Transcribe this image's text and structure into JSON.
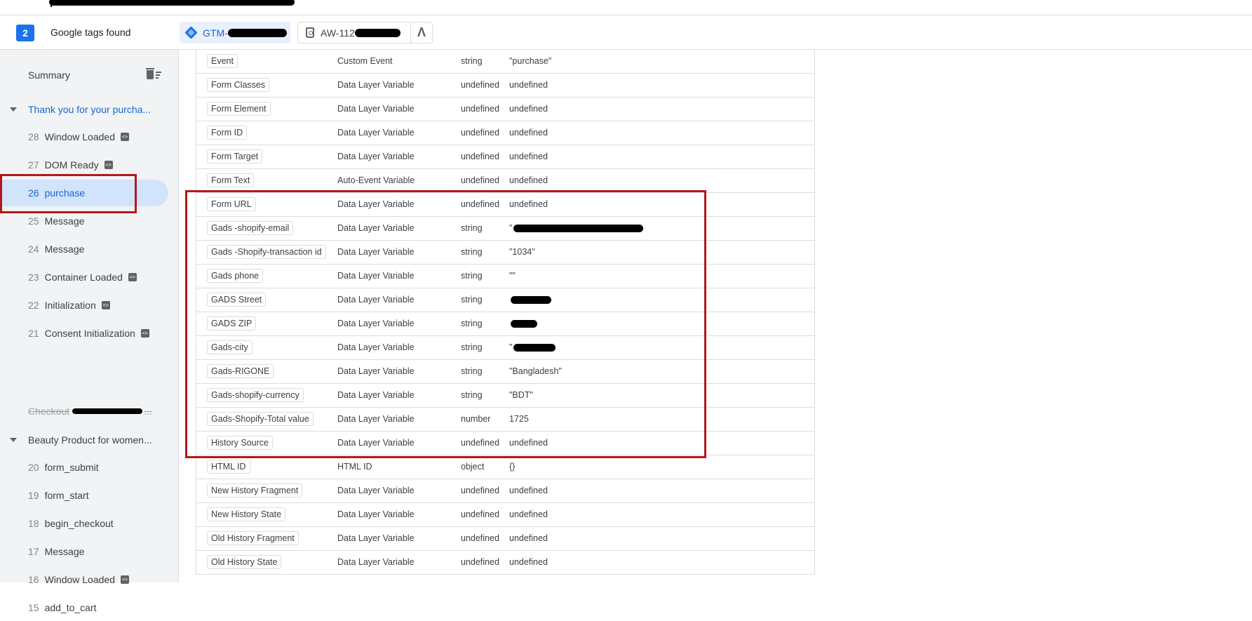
{
  "header": {
    "tag_count": "2",
    "tags_found_label": "Google tags found",
    "gtm_chip_label": "GTM-",
    "aw_chip_label": "AW-112"
  },
  "sidebar": {
    "summary_label": "Summary",
    "groups": [
      {
        "label": "Thank you for your purcha...",
        "items": [
          {
            "num": "28",
            "label": "Window Loaded",
            "badge": true
          },
          {
            "num": "27",
            "label": "DOM Ready",
            "badge": true
          },
          {
            "num": "26",
            "label": "purchase",
            "badge": false,
            "selected": true
          },
          {
            "num": "25",
            "label": "Message",
            "badge": false
          },
          {
            "num": "24",
            "label": "Message",
            "badge": false
          },
          {
            "num": "23",
            "label": "Container Loaded",
            "badge": true
          },
          {
            "num": "22",
            "label": "Initialization",
            "badge": true
          },
          {
            "num": "21",
            "label": "Consent Initialization",
            "badge": true
          }
        ]
      },
      {
        "label": "Beauty Product for women...",
        "items": [
          {
            "num": "20",
            "label": "form_submit",
            "badge": false
          },
          {
            "num": "19",
            "label": "form_start",
            "badge": false
          },
          {
            "num": "18",
            "label": "begin_checkout",
            "badge": false
          },
          {
            "num": "17",
            "label": "Message",
            "badge": false
          },
          {
            "num": "16",
            "label": "Window Loaded",
            "badge": true
          },
          {
            "num": "15",
            "label": "add_to_cart",
            "badge": false
          }
        ]
      }
    ],
    "checkout_label": "Checkout"
  },
  "variables": [
    {
      "name": "",
      "type": "Data Layer Variable",
      "vtype": "undefined",
      "value": "undefined"
    },
    {
      "name": "Event",
      "type": "Custom Event",
      "vtype": "string",
      "value": "\"purchase\""
    },
    {
      "name": "Form Classes",
      "type": "Data Layer Variable",
      "vtype": "undefined",
      "value": "undefined"
    },
    {
      "name": "Form Element",
      "type": "Data Layer Variable",
      "vtype": "undefined",
      "value": "undefined"
    },
    {
      "name": "Form ID",
      "type": "Data Layer Variable",
      "vtype": "undefined",
      "value": "undefined"
    },
    {
      "name": "Form Target",
      "type": "Data Layer Variable",
      "vtype": "undefined",
      "value": "undefined"
    },
    {
      "name": "Form Text",
      "type": "Auto-Event Variable",
      "vtype": "undefined",
      "value": "undefined"
    },
    {
      "name": "Form URL",
      "type": "Data Layer Variable",
      "vtype": "undefined",
      "value": "undefined"
    },
    {
      "name": "Gads -shopify-email",
      "type": "Data Layer Variable",
      "vtype": "string",
      "value": "\"",
      "redacted": 185
    },
    {
      "name": "Gads -Shopify-transaction id",
      "type": "Data Layer Variable",
      "vtype": "string",
      "value": "\"1034\""
    },
    {
      "name": "Gads phone",
      "type": "Data Layer Variable",
      "vtype": "string",
      "value": "\"\""
    },
    {
      "name": "GADS Street",
      "type": "Data Layer Variable",
      "vtype": "string",
      "value": "",
      "redacted": 58
    },
    {
      "name": "GADS ZIP",
      "type": "Data Layer Variable",
      "vtype": "string",
      "value": "",
      "redacted": 38
    },
    {
      "name": "Gads-city",
      "type": "Data Layer Variable",
      "vtype": "string",
      "value": "\"",
      "redacted": 60
    },
    {
      "name": "Gads-RIGONE",
      "type": "Data Layer Variable",
      "vtype": "string",
      "value": "\"Bangladesh\""
    },
    {
      "name": "Gads-shopify-currency",
      "type": "Data Layer Variable",
      "vtype": "string",
      "value": "\"BDT\""
    },
    {
      "name": "Gads-Shopify-Total value",
      "type": "Data Layer Variable",
      "vtype": "number",
      "value": "1725"
    },
    {
      "name": "History Source",
      "type": "Data Layer Variable",
      "vtype": "undefined",
      "value": "undefined"
    },
    {
      "name": "HTML ID",
      "type": "HTML ID",
      "vtype": "object",
      "value": "{}"
    },
    {
      "name": "New History Fragment",
      "type": "Data Layer Variable",
      "vtype": "undefined",
      "value": "undefined"
    },
    {
      "name": "New History State",
      "type": "Data Layer Variable",
      "vtype": "undefined",
      "value": "undefined"
    },
    {
      "name": "Old History Fragment",
      "type": "Data Layer Variable",
      "vtype": "undefined",
      "value": "undefined"
    },
    {
      "name": "Old History State",
      "type": "Data Layer Variable",
      "vtype": "undefined",
      "value": "undefined"
    }
  ],
  "colors": {
    "accent": "#1a73e8",
    "selected_bg": "#d2e3fc",
    "annotation_red": "#b3181c"
  }
}
